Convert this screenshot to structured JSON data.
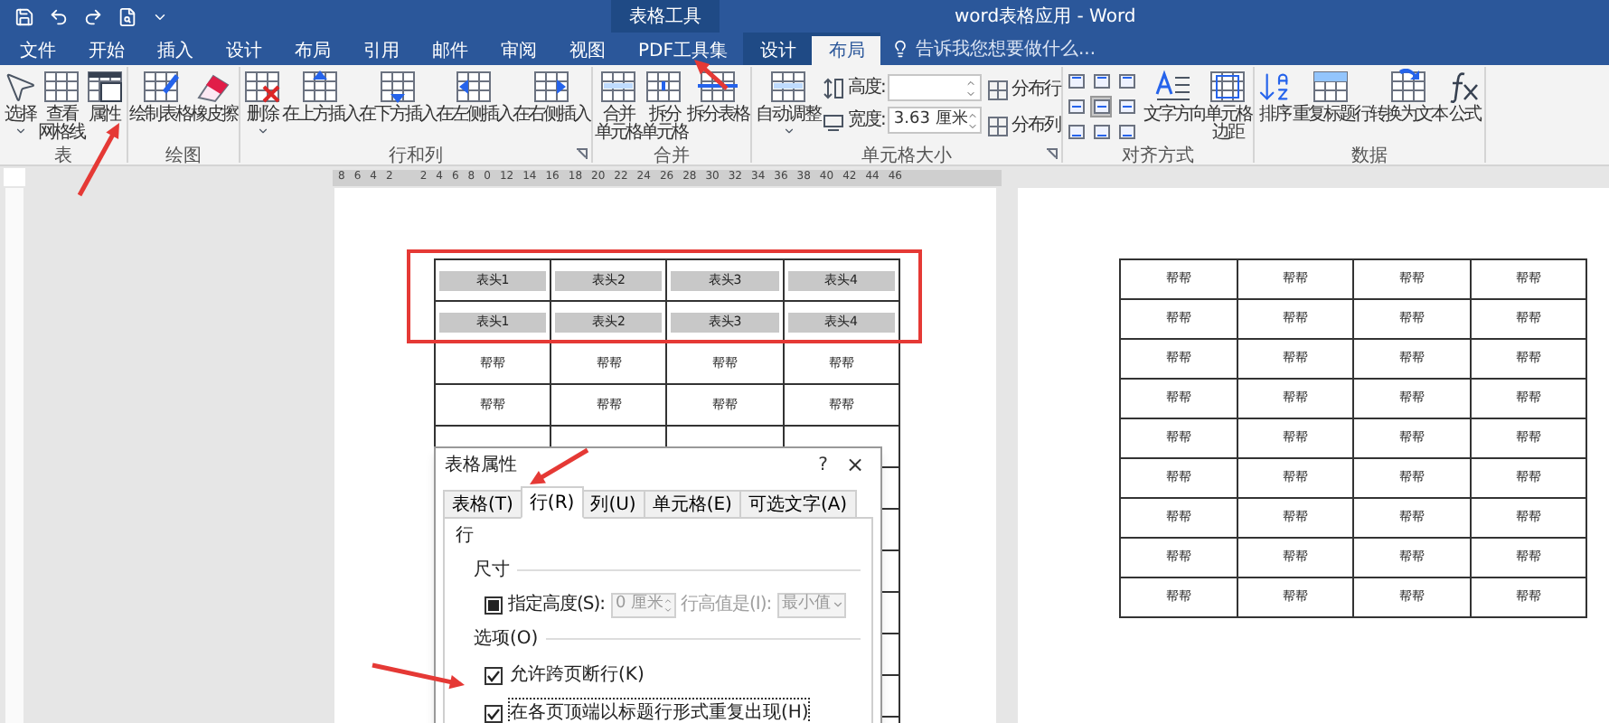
{
  "window": {
    "title": "word表格应用 - Word",
    "context_title": "表格工具"
  },
  "tabs": [
    {
      "label": "文件",
      "selected": false,
      "kind": "main"
    },
    {
      "label": "开始",
      "selected": false,
      "kind": "main"
    },
    {
      "label": "插入",
      "selected": false,
      "kind": "main"
    },
    {
      "label": "设计",
      "selected": false,
      "kind": "main"
    },
    {
      "label": "布局",
      "selected": false,
      "kind": "main"
    },
    {
      "label": "引用",
      "selected": false,
      "kind": "main"
    },
    {
      "label": "邮件",
      "selected": false,
      "kind": "main"
    },
    {
      "label": "审阅",
      "selected": false,
      "kind": "main"
    },
    {
      "label": "视图",
      "selected": false,
      "kind": "main"
    },
    {
      "label": "PDF工具集",
      "selected": false,
      "kind": "main"
    },
    {
      "label": "设计",
      "selected": false,
      "kind": "context"
    },
    {
      "label": "布局",
      "selected": true,
      "kind": "context"
    }
  ],
  "search": {
    "placeholder": "告诉我您想要做什么..."
  },
  "ribbon": {
    "groups": [
      {
        "label": "表",
        "kind": "buttons",
        "launcher": false,
        "items": [
          {
            "lines": [
              "选择"
            ],
            "dropdown": true
          },
          {
            "lines": [
              "查看",
              "网格线"
            ],
            "dropdown": false
          },
          {
            "lines": [
              "属性"
            ],
            "dropdown": false
          }
        ]
      },
      {
        "label": "绘图",
        "kind": "buttons",
        "launcher": false,
        "items": [
          {
            "lines": [
              "绘制表格"
            ],
            "dropdown": false
          },
          {
            "lines": [
              "橡皮擦"
            ],
            "dropdown": false
          }
        ]
      },
      {
        "label": "行和列",
        "kind": "buttons",
        "launcher": true,
        "items": [
          {
            "lines": [
              "删除"
            ],
            "dropdown": true
          },
          {
            "lines": [
              "在上方插入"
            ],
            "dropdown": false
          },
          {
            "lines": [
              "在下方插入"
            ],
            "dropdown": false
          },
          {
            "lines": [
              "在左侧插入"
            ],
            "dropdown": false
          },
          {
            "lines": [
              "在右侧插入"
            ],
            "dropdown": false
          }
        ]
      },
      {
        "label": "合并",
        "kind": "buttons",
        "launcher": false,
        "items": [
          {
            "lines": [
              "合并",
              "单元格"
            ],
            "dropdown": false
          },
          {
            "lines": [
              "拆分",
              "单元格"
            ],
            "dropdown": false
          },
          {
            "lines": [
              "拆分表格"
            ],
            "dropdown": false
          }
        ]
      },
      {
        "label": "单元格大小",
        "kind": "size",
        "launcher": true,
        "autofit": {
          "lines": [
            "自动调整"
          ],
          "dropdown": true
        },
        "height": {
          "label": "高度:"
        },
        "width": {
          "label": "宽度:",
          "value": "3.63 厘米"
        },
        "distribute": [
          "分布行",
          "分布列"
        ]
      },
      {
        "label": "对齐方式",
        "kind": "align",
        "launcher": false,
        "cells": [
          {
            "selected": false
          },
          {
            "selected": false
          },
          {
            "selected": false
          },
          {
            "selected": false
          },
          {
            "selected": true
          },
          {
            "selected": false
          },
          {
            "selected": false
          },
          {
            "selected": false
          },
          {
            "selected": false
          }
        ],
        "items": [
          {
            "lines": [
              "文字方向"
            ],
            "dropdown": false
          },
          {
            "lines": [
              "单元格",
              "边距"
            ],
            "dropdown": false
          }
        ]
      },
      {
        "label": "数据",
        "kind": "buttons",
        "launcher": false,
        "items": [
          {
            "lines": [
              "排序"
            ],
            "dropdown": false
          },
          {
            "lines": [
              "重复标题行"
            ],
            "dropdown": false
          },
          {
            "lines": [
              "转换为文本"
            ],
            "dropdown": false
          },
          {
            "lines": [
              "公式"
            ],
            "dropdown": false
          }
        ]
      }
    ]
  },
  "ruler": {
    "labels": [
      "8",
      "6",
      "4",
      "2",
      "2",
      "4",
      "6",
      "8",
      "0",
      "12",
      "14",
      "16",
      "18",
      "20",
      "22",
      "24",
      "26",
      "28",
      "30",
      "32",
      "34",
      "36",
      "38",
      "40",
      "42",
      "44",
      "46"
    ]
  },
  "page_1_table": {
    "rows": [
      {
        "kind": "header",
        "cells": [
          "表头1",
          "表头2",
          "表头3",
          "表头4"
        ]
      },
      {
        "kind": "header",
        "cells": [
          "表头1",
          "表头2",
          "表头3",
          "表头4"
        ]
      },
      {
        "kind": "data",
        "cells": [
          "帮帮",
          "帮帮",
          "帮帮",
          "帮帮"
        ]
      },
      {
        "kind": "data",
        "cells": [
          "帮帮",
          "帮帮",
          "帮帮",
          "帮帮"
        ]
      }
    ]
  },
  "page_2_table": {
    "rows": [
      [
        "帮帮",
        "帮帮",
        "帮帮",
        "帮帮"
      ],
      [
        "帮帮",
        "帮帮",
        "帮帮",
        "帮帮"
      ],
      [
        "帮帮",
        "帮帮",
        "帮帮",
        "帮帮"
      ],
      [
        "帮帮",
        "帮帮",
        "帮帮",
        "帮帮"
      ],
      [
        "帮帮",
        "帮帮",
        "帮帮",
        "帮帮"
      ],
      [
        "帮帮",
        "帮帮",
        "帮帮",
        "帮帮"
      ],
      [
        "帮帮",
        "帮帮",
        "帮帮",
        "帮帮"
      ],
      [
        "帮帮",
        "帮帮",
        "帮帮",
        "帮帮"
      ],
      [
        "帮帮",
        "帮帮",
        "帮帮",
        "帮帮"
      ]
    ]
  },
  "dialog": {
    "title": "表格属性",
    "help": "?",
    "close": "×",
    "tabs": [
      {
        "label": "表格(T)",
        "selected": false
      },
      {
        "label": "行(R)",
        "selected": true
      },
      {
        "label": "列(U)",
        "selected": false
      },
      {
        "label": "单元格(E)",
        "selected": false
      },
      {
        "label": "可选文字(A)",
        "selected": false
      }
    ],
    "section": "行",
    "size_heading": "尺寸",
    "height_check": {
      "label": "指定高度(S):",
      "checked": false,
      "mixed": true
    },
    "height_field": {
      "value": "0 厘米",
      "disabled": true
    },
    "rule_label": {
      "label": "行高值是(I):",
      "disabled": true
    },
    "rule_select": {
      "value": "最小值",
      "disabled": true
    },
    "options_heading": "选项(O)",
    "options": [
      {
        "label": "允许跨页断行(K)",
        "checked": true,
        "focused": false
      },
      {
        "label": "在各页顶端以标题行形式重复出现(H)",
        "checked": true,
        "focused": true
      }
    ]
  }
}
